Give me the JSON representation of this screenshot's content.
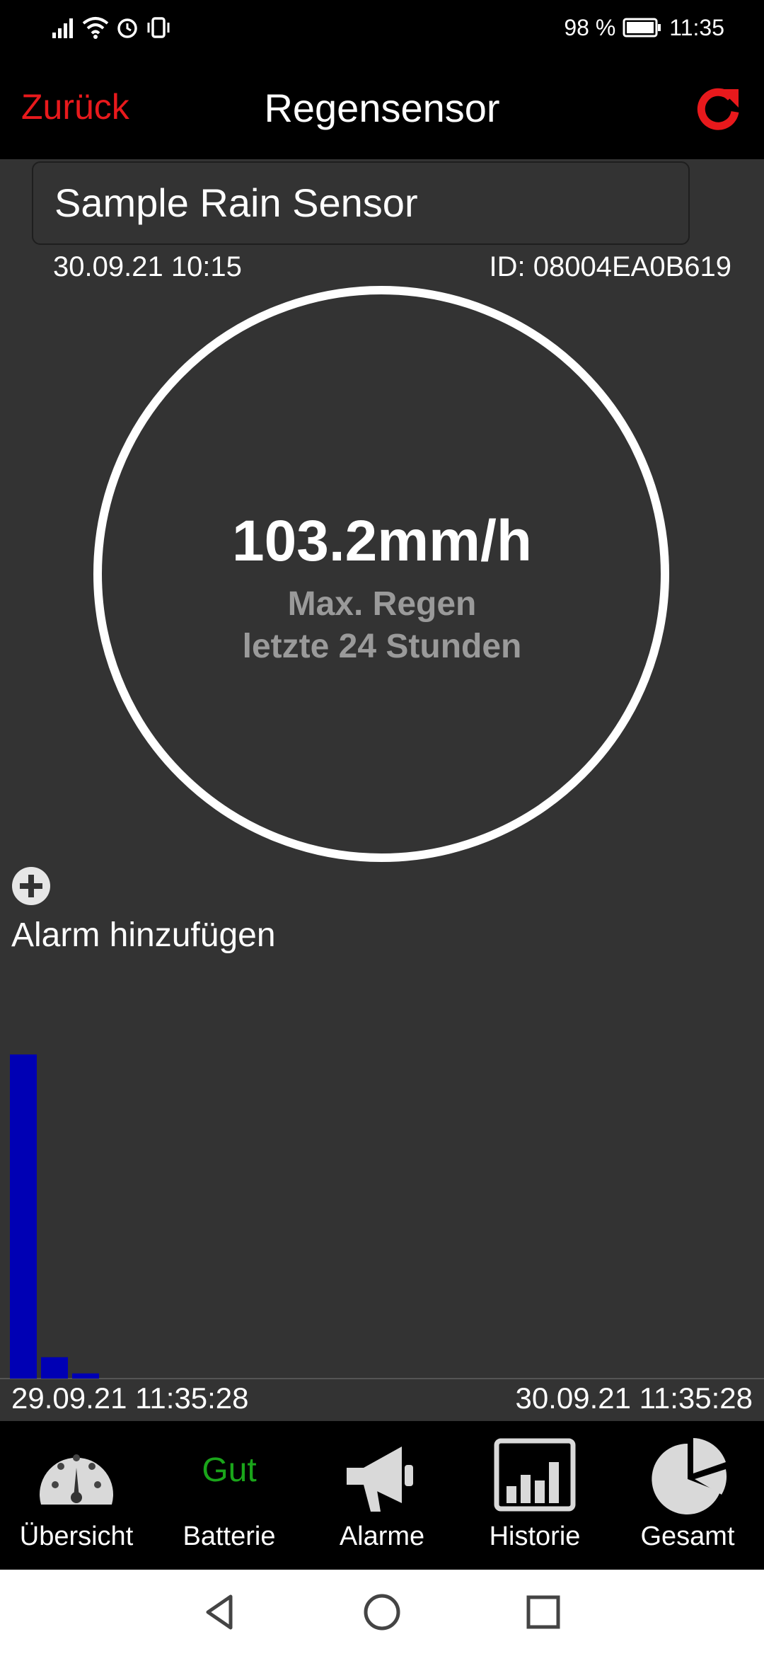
{
  "status_bar": {
    "battery": "98 %",
    "time": "11:35"
  },
  "header": {
    "back_label": "Zurück",
    "title": "Regensensor",
    "refresh_icon": "refresh-icon"
  },
  "sensor": {
    "name": "Sample Rain Sensor",
    "date": "30.09.21  10:15",
    "id": "ID: 08004EA0B619",
    "value": "103.2mm/h",
    "caption_line1": "Max. Regen",
    "caption_line2": "letzte 24 Stunden"
  },
  "alarm": {
    "add_label": "Alarm hinzufügen"
  },
  "chart_data": {
    "type": "bar",
    "bar_color": "#0000b4",
    "values": [
      1.0,
      0.066,
      0.016
    ],
    "x_start_label": "29.09.21  11:35:28",
    "x_end_label": "30.09.21  11:35:28"
  },
  "tabs": [
    {
      "label": "Übersicht",
      "icon": "gauge-icon"
    },
    {
      "label": "Batterie",
      "status": "Gut"
    },
    {
      "label": "Alarme",
      "icon": "megaphone-icon"
    },
    {
      "label": "Historie",
      "icon": "bar-chart-icon"
    },
    {
      "label": "Gesamt",
      "icon": "pie-chart-icon"
    }
  ],
  "colors": {
    "accent": "#e8191c",
    "background": "#333333",
    "battery_good": "#1aa51a"
  }
}
